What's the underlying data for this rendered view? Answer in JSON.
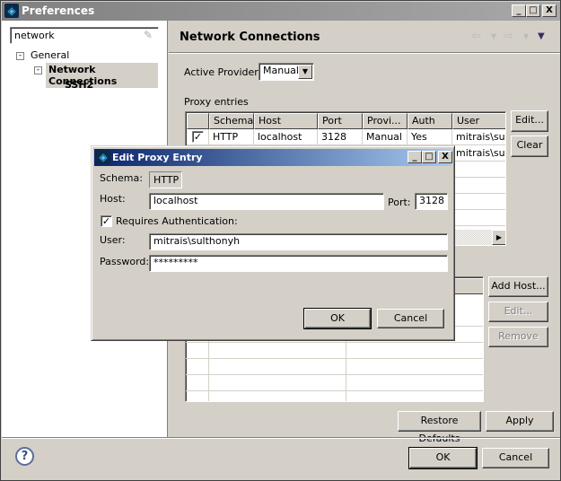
{
  "window": {
    "title": "Preferences",
    "minimize": "_",
    "maximize": "□",
    "close": "X"
  },
  "sidebar": {
    "search_value": "network",
    "tree": [
      {
        "label": "General"
      },
      {
        "label": "Network Connections"
      },
      {
        "label": "SSH2"
      }
    ]
  },
  "page": {
    "title": "Network Connections",
    "active_provider_label": "Active Provider:",
    "active_provider_value": "Manual",
    "proxy_entries_label": "Proxy entries",
    "proxy_columns": [
      "Schema",
      "Host",
      "Port",
      "Provi...",
      "Auth",
      "User"
    ],
    "proxy_rows": [
      {
        "checked": true,
        "schema": "HTTP",
        "host": "localhost",
        "port": "3128",
        "provider": "Manual",
        "auth": "Yes",
        "user": "mitrais\\su.."
      },
      {
        "user": "mitrais\\su.."
      }
    ],
    "edit_label": "Edit...",
    "clear_label": "Clear",
    "add_host_label": "Add Host...",
    "bypass_edit_label": "Edit...",
    "remove_label": "Remove",
    "restore_defaults_label": "Restore Defaults",
    "apply_label": "Apply"
  },
  "footer": {
    "ok_label": "OK",
    "cancel_label": "Cancel",
    "help": "?"
  },
  "dialog": {
    "title": "Edit Proxy Entry",
    "schema_label": "Schema:",
    "schema_value": "HTTP",
    "host_label": "Host:",
    "host_value": "localhost",
    "port_label": "Port:",
    "port_value": "3128",
    "requires_auth_label": "Requires Authentication:",
    "requires_auth_checked": true,
    "user_label": "User:",
    "user_value": "mitrais\\sulthonyh",
    "password_label": "Password:",
    "password_value": "*********",
    "ok_label": "OK",
    "cancel_label": "Cancel"
  }
}
